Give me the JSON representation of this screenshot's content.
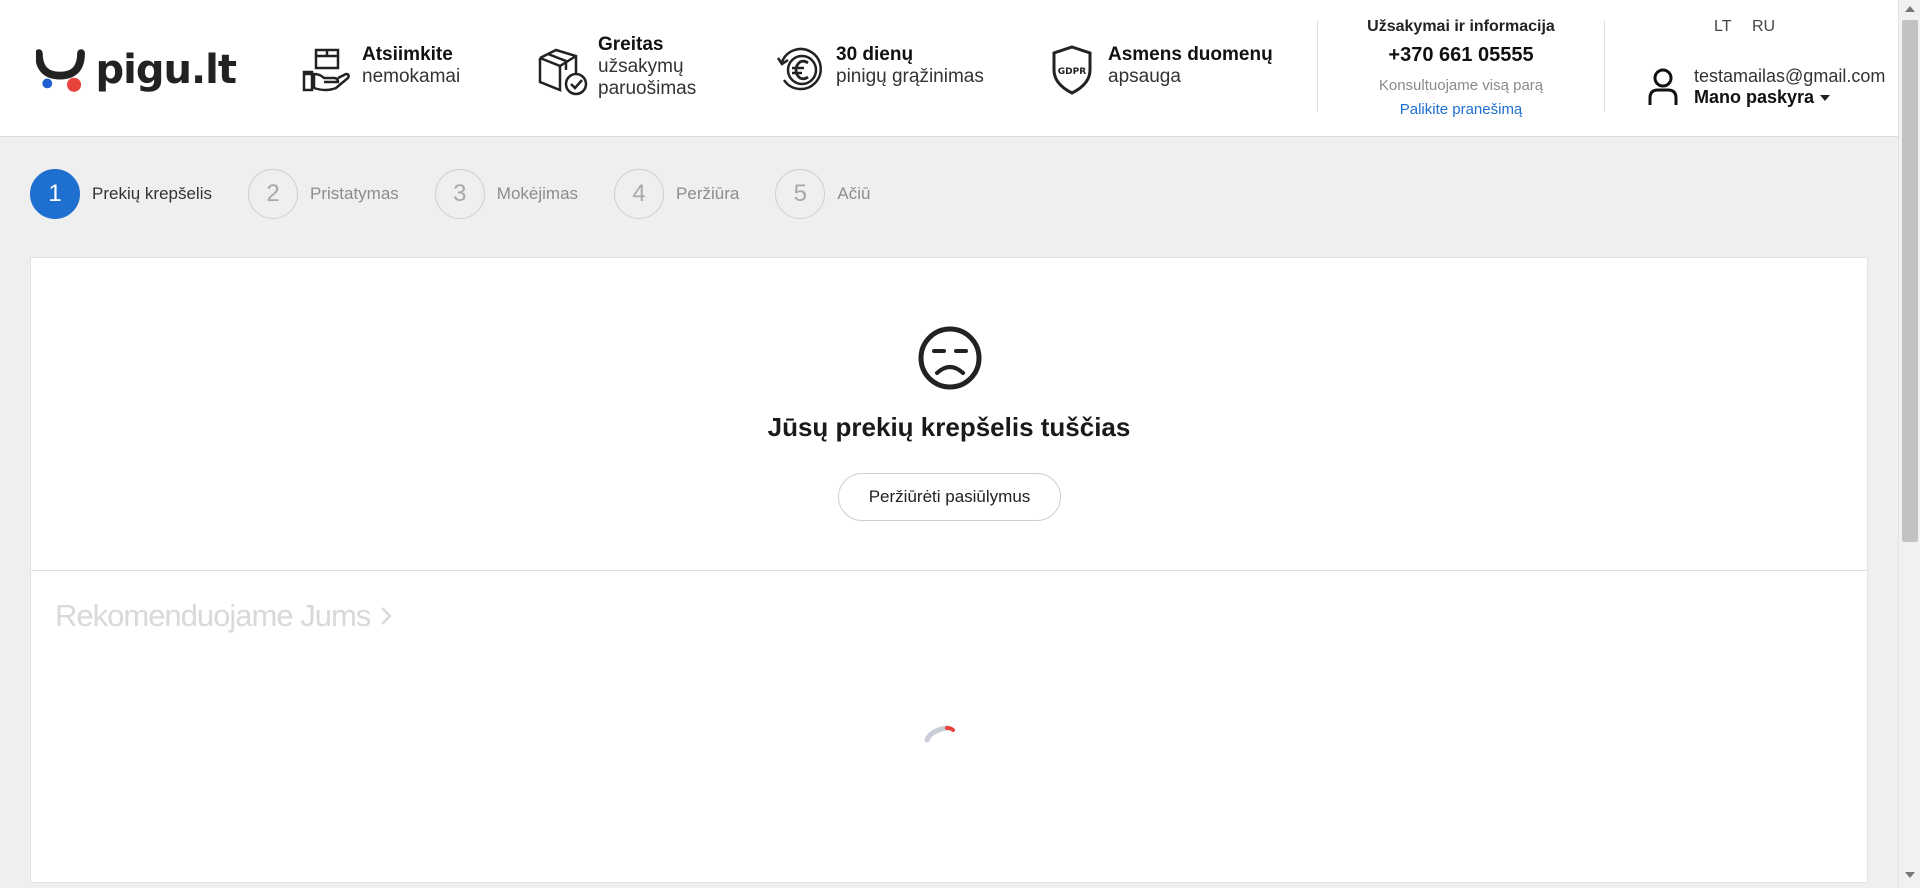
{
  "logo": {
    "text": "pigu.lt",
    "colors": {
      "dark": "#222222",
      "blue": "#1f5fd0",
      "red": "#e8423c"
    }
  },
  "features": [
    {
      "icon": "hand-box-icon",
      "title": "Atsiimkite",
      "subtitle": "nemokamai"
    },
    {
      "icon": "box-check-icon",
      "title": "Greitas",
      "subtitle": "užsakymų",
      "subtitle2": "paruošimas"
    },
    {
      "icon": "euro-refund-icon",
      "title": "30 dienų",
      "subtitle": "pinigų grąžinimas"
    },
    {
      "icon": "gdpr-shield-icon",
      "badge": "GDPR",
      "title": "Asmens duomenų",
      "subtitle": "apsauga"
    }
  ],
  "contact": {
    "title": "Užsakymai ir informacija",
    "phone": "+370 661 05555",
    "consult": "Konsultuojame visą parą",
    "link": "Palikite pranešimą"
  },
  "languages": [
    "LT",
    "RU"
  ],
  "account": {
    "email": "testamailas@gmail.com",
    "label": "Mano paskyra"
  },
  "steps": [
    {
      "num": "1",
      "label": "Prekių krepšelis",
      "active": true
    },
    {
      "num": "2",
      "label": "Pristatymas"
    },
    {
      "num": "3",
      "label": "Mokėjimas"
    },
    {
      "num": "4",
      "label": "Peržiūra"
    },
    {
      "num": "5",
      "label": "Ačiū"
    }
  ],
  "cart": {
    "empty_title": "Jūsų prekių krepšelis tuščias",
    "offers_button": "Peržiūrėti pasiūlymus"
  },
  "recommend": {
    "title": "Rekomenduojame Jums"
  },
  "accent": "#1f6fd0"
}
